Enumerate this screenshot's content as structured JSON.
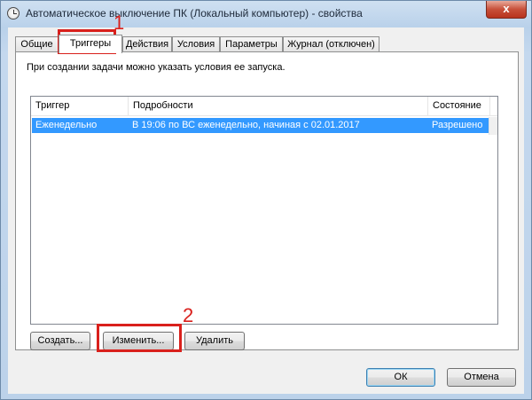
{
  "window": {
    "title": "Автоматическое выключение ПК (Локальный компьютер) - свойства",
    "close_glyph": "x"
  },
  "tabs": [
    {
      "label": "Общие",
      "active": false
    },
    {
      "label": "Триггеры",
      "active": true
    },
    {
      "label": "Действия",
      "active": false
    },
    {
      "label": "Условия",
      "active": false
    },
    {
      "label": "Параметры",
      "active": false
    },
    {
      "label": "Журнал (отключен)",
      "active": false
    }
  ],
  "panel": {
    "description": "При создании задачи можно указать условия ее запуска."
  },
  "triggers_list": {
    "columns": [
      "Триггер",
      "Подробности",
      "Состояние"
    ],
    "rows": [
      {
        "trigger": "Еженедельно",
        "details": "В 19:06 по ВС еженедельно, начиная с 02.01.2017",
        "state": "Разрешено",
        "selected": true
      }
    ]
  },
  "buttons": {
    "create": "Создать...",
    "edit": "Изменить...",
    "delete": "Удалить",
    "ok": "ОК",
    "cancel": "Отмена"
  },
  "annotations": {
    "marker_1": "1",
    "marker_2": "2",
    "color": "#d9201c"
  },
  "colors": {
    "selection": "#3399ff",
    "dialog_bg": "#f0f0f0"
  }
}
